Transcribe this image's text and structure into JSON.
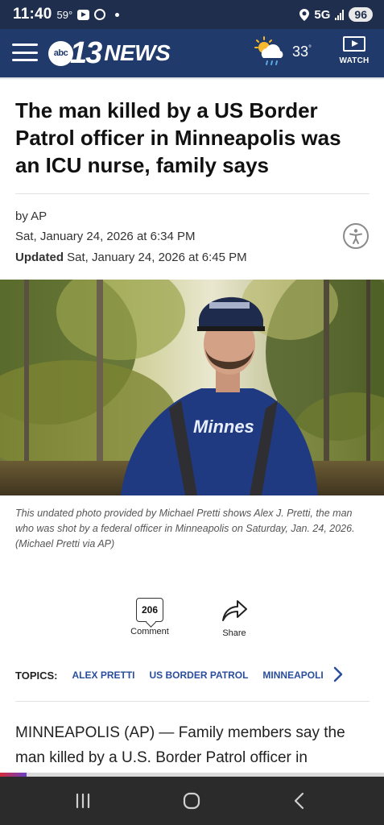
{
  "status_bar": {
    "time": "11:40",
    "temp": "59°",
    "network": "5G",
    "battery": "96"
  },
  "header": {
    "logo_abc": "abc",
    "logo_number": "13",
    "logo_news": "NEWS",
    "weather_icon": "partly-cloudy-rain-icon",
    "temperature": "33",
    "temperature_unit": "°",
    "watch_label": "WATCH"
  },
  "article": {
    "headline": "The man killed by a US Border Patrol officer in Minneapolis was an ICU nurse, family says",
    "byline": "by AP",
    "published": "Sat, January 24, 2026 at 6:34 PM",
    "updated_label": "Updated",
    "updated": "Sat, January 24, 2026 at 6:45 PM",
    "photo_jersey_text": "Minnes",
    "caption": "This undated photo provided by Michael Pretti shows Alex J. Pretti, the man who was shot by a federal officer in Minneapolis on Saturday, Jan. 24, 2026. (Michael Pretti via AP)",
    "comment_count": "206",
    "comment_label": "Comment",
    "share_label": "Share",
    "topics_label": "TOPICS:",
    "topics": [
      "ALEX PRETTI",
      "US BORDER PATROL",
      "MINNEAPOLIS"
    ],
    "body_start": "MINNEAPOLIS (AP) — Family members say the man killed by a U.S. Border Patrol officer in"
  },
  "reading_progress": 0.07,
  "colors": {
    "status_bar": "#1f2e4d",
    "header": "#1f3a6b",
    "topic_link": "#2a4e9c",
    "nav_bar": "#2b2b2b"
  }
}
